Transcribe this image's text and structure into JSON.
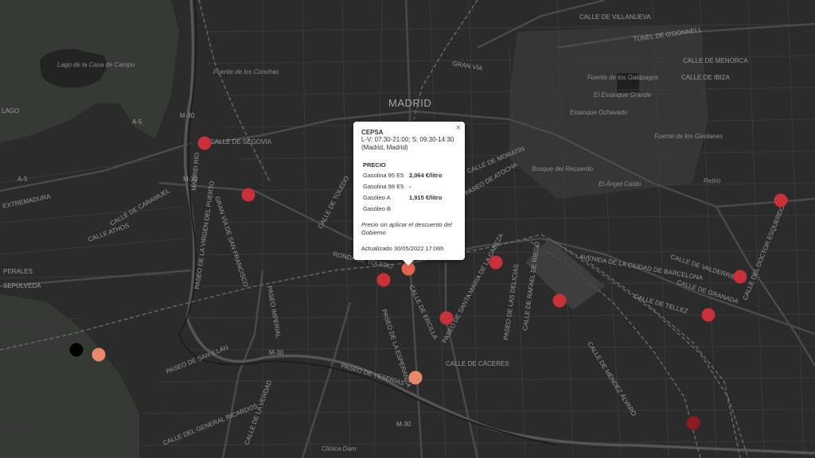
{
  "map": {
    "city_label": "MADRID",
    "place_labels": [
      "Lago de la Casa de Campo",
      "Fuente de los Conchas",
      "Fuente de los Galápagos",
      "El Estanque Grande",
      "Estanque Ochavado",
      "Fuente de los Gavilanes",
      "Bosque del Recuerdo",
      "El Ángel Caído",
      "Retiro",
      "Clínica Dam"
    ],
    "street_labels": [
      "CALLE DE VILLANUEVA",
      "TÚNEL DE O'DONNELL",
      "CALLE DE MENORCA",
      "CALLE DE IBIZA",
      "GRAN VÍA",
      "CALLE DE MORATÍN",
      "PASEO DE ATOCHA",
      "CALLE DE TOLEDO",
      "RONDA DE TOLEDO",
      "AVENIDA DE LA CIUDAD DE BARCELONA",
      "CALLE DEL DOCTOR ESQUERDO",
      "CALLE DE VALDERRIBAS",
      "CALLE DE GRANADA",
      "CALLE DE TELLEZ",
      "CALLE DE ERCILLA",
      "PASEO DE SANTA MARÍA DE LA CABEZA",
      "PASEO DE LAS DELICIAS",
      "CALLE DE RAFAEL DE RIEGO",
      "CALLE DE CÁCERES",
      "PASEO DE LA ESPERANZA",
      "PASEO IMPERIAL",
      "PASEO DE SAN ILLÁN",
      "PASEO DE YESERÍAS",
      "CALLE DE MÉNDEZ ÁLVARO",
      "CALLE DEL GENERAL RICARDOS",
      "CALLE DE LA VERDAD",
      "MADRID RÍO",
      "PASEO DE LA VIRGEN DEL PUERTO",
      "CALLE DE SEGOVIA",
      "EXTREMADURA",
      "SEPÚLVEDA",
      "PERALES",
      "CALLE ATHOS",
      "CALLE DE CARAMUEL",
      "GRAN VÍA DE SAN FRANCISCO",
      "M-30",
      "A-5",
      "LAGO"
    ],
    "markers": [
      {
        "color": "#c8303a"
      },
      {
        "color": "#c8303a"
      },
      {
        "color": "#e0634f"
      },
      {
        "color": "#c8303a"
      },
      {
        "color": "#c8303a"
      },
      {
        "color": "#c8303a"
      },
      {
        "color": "#c8303a"
      },
      {
        "color": "#c8303a"
      },
      {
        "color": "#c8303a"
      },
      {
        "color": "#c8303a"
      },
      {
        "color": "#e9886b"
      },
      {
        "color": "#e9886b"
      },
      {
        "color": "#8f1b22"
      },
      {
        "color": "#000000"
      }
    ]
  },
  "popup": {
    "close_glyph": "×",
    "station": "CEPSA",
    "hours": "L-V: 07:30-21:00; S: 09:30-14:30",
    "place": "(Madrid, Madrid)",
    "price_heading": "PRECIO",
    "prices": [
      {
        "fuel": "Gasolina 95 E5",
        "price": "2,064 €/litro"
      },
      {
        "fuel": "Gasolina 98 E5",
        "price": "-"
      },
      {
        "fuel": "Gasóleo A",
        "price": "1,915 €/litro"
      },
      {
        "fuel": "Gasóleo B",
        "price": ""
      }
    ],
    "note": "Precio sin aplicar el descuento del Gobierno",
    "updated": "Actualizado 30/05/2022 17:06h"
  }
}
